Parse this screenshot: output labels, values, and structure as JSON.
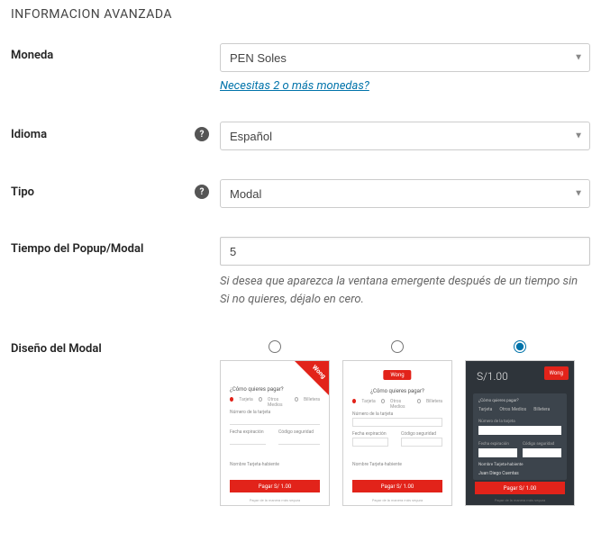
{
  "section_title": "INFORMACION AVANZADA",
  "fields": {
    "moneda": {
      "label": "Moneda",
      "value": "PEN Soles",
      "link": "Necesitas 2 o más monedas?"
    },
    "idioma": {
      "label": "Idioma",
      "value": "Español"
    },
    "tipo": {
      "label": "Tipo",
      "value": "Modal"
    },
    "tiempo": {
      "label": "Tiempo del Popup/Modal",
      "value": "5",
      "desc_line1": "Si desea que aparezca la ventana emergente después de un tiempo sin",
      "desc_line2": "Si no quieres, déjalo en cero."
    },
    "diseno": {
      "label": "Diseño del Modal"
    }
  },
  "preview": {
    "brand": "Wong",
    "question": "¿Cómo quieres pagar?",
    "tab_tarjeta": "Tarjeta",
    "tab_otros": "Otros Medios",
    "tab_billetera": "Billetera",
    "lbl_numero": "Número de la tarjeta",
    "lbl_fecha": "Fecha expiración",
    "lbl_codigo": "Código seguridad",
    "lbl_nombre": "Nombre Tarjeta-habiente",
    "name_example": "Juan Diego Cuentas",
    "pay_label": "Pagar S/ 1.00",
    "footer": "Pagar de la manera más segura",
    "amount": "S/1.00",
    "question2": "¿Cómo quieres pagar?"
  }
}
